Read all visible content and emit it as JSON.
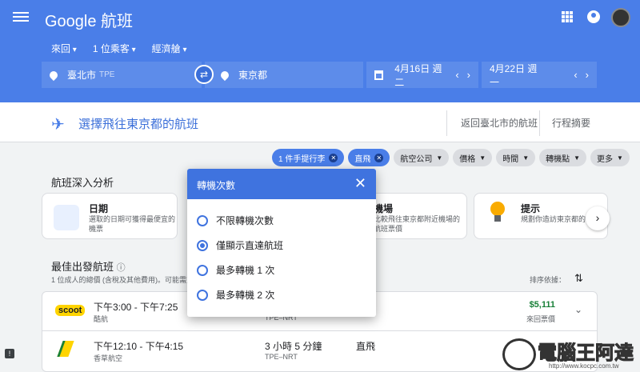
{
  "app": {
    "logo": "Google 航班"
  },
  "options": [
    "來回",
    "1 位乘客",
    "經濟艙"
  ],
  "search": {
    "origin": "臺北市",
    "origin_code": "TPE",
    "destination": "東京都",
    "depart": "4月16日 週二",
    "return": "4月22日 週一"
  },
  "step": {
    "title": "選擇飛往東京都的航班",
    "crumb_return": "返回臺北市的航班",
    "crumb_summary": "行程摘要"
  },
  "chips": [
    {
      "label": "1 件手提行李",
      "active": true
    },
    {
      "label": "直飛",
      "active": true
    },
    {
      "label": "航空公司",
      "active": false
    },
    {
      "label": "價格",
      "active": false
    },
    {
      "label": "時間",
      "active": false
    },
    {
      "label": "轉機點",
      "active": false
    },
    {
      "label": "更多",
      "active": false
    }
  ],
  "insights": {
    "title": "航班深入分析",
    "cards": [
      {
        "title": "日期",
        "desc1": "選取的日期可獲得最便宜的",
        "desc2": "機票"
      },
      {
        "title": "機場",
        "desc1": "比較飛往東京都附近機場的",
        "desc2": "航班票價"
      },
      {
        "title": "提示",
        "desc1": "規劃你造訪東京都的行",
        "desc2": ""
      }
    ]
  },
  "best": {
    "title": "最佳出發航班",
    "note": "1 位成人的總價 (含稅及其他費用)。可能需支",
    "sort_label": "排序依據："
  },
  "flights": [
    {
      "time": "下午3:00 - 下午7:25",
      "airline": "酷航",
      "duration": "",
      "route": "TPE–NRT",
      "stops": "",
      "price": "$5,111",
      "price_note": "來回票價"
    },
    {
      "time": "下午12:10 - 下午4:15",
      "airline": "香草航空",
      "duration": "3 小時 5 分鐘",
      "route": "TPE–NRT",
      "stops": "直飛",
      "price": "",
      "price_note": ""
    }
  ],
  "dialog": {
    "title": "轉機次數",
    "options": [
      "不限轉機次數",
      "僅顯示直達航班",
      "最多轉機 1 次",
      "最多轉機 2 次"
    ],
    "selected": 1
  },
  "watermark": {
    "brand": "電腦王阿達",
    "url": "http://www.kocpc.com.tw"
  },
  "colors": {
    "header": "#4a7ee8",
    "accent": "#3f73df",
    "price": "#188038"
  }
}
